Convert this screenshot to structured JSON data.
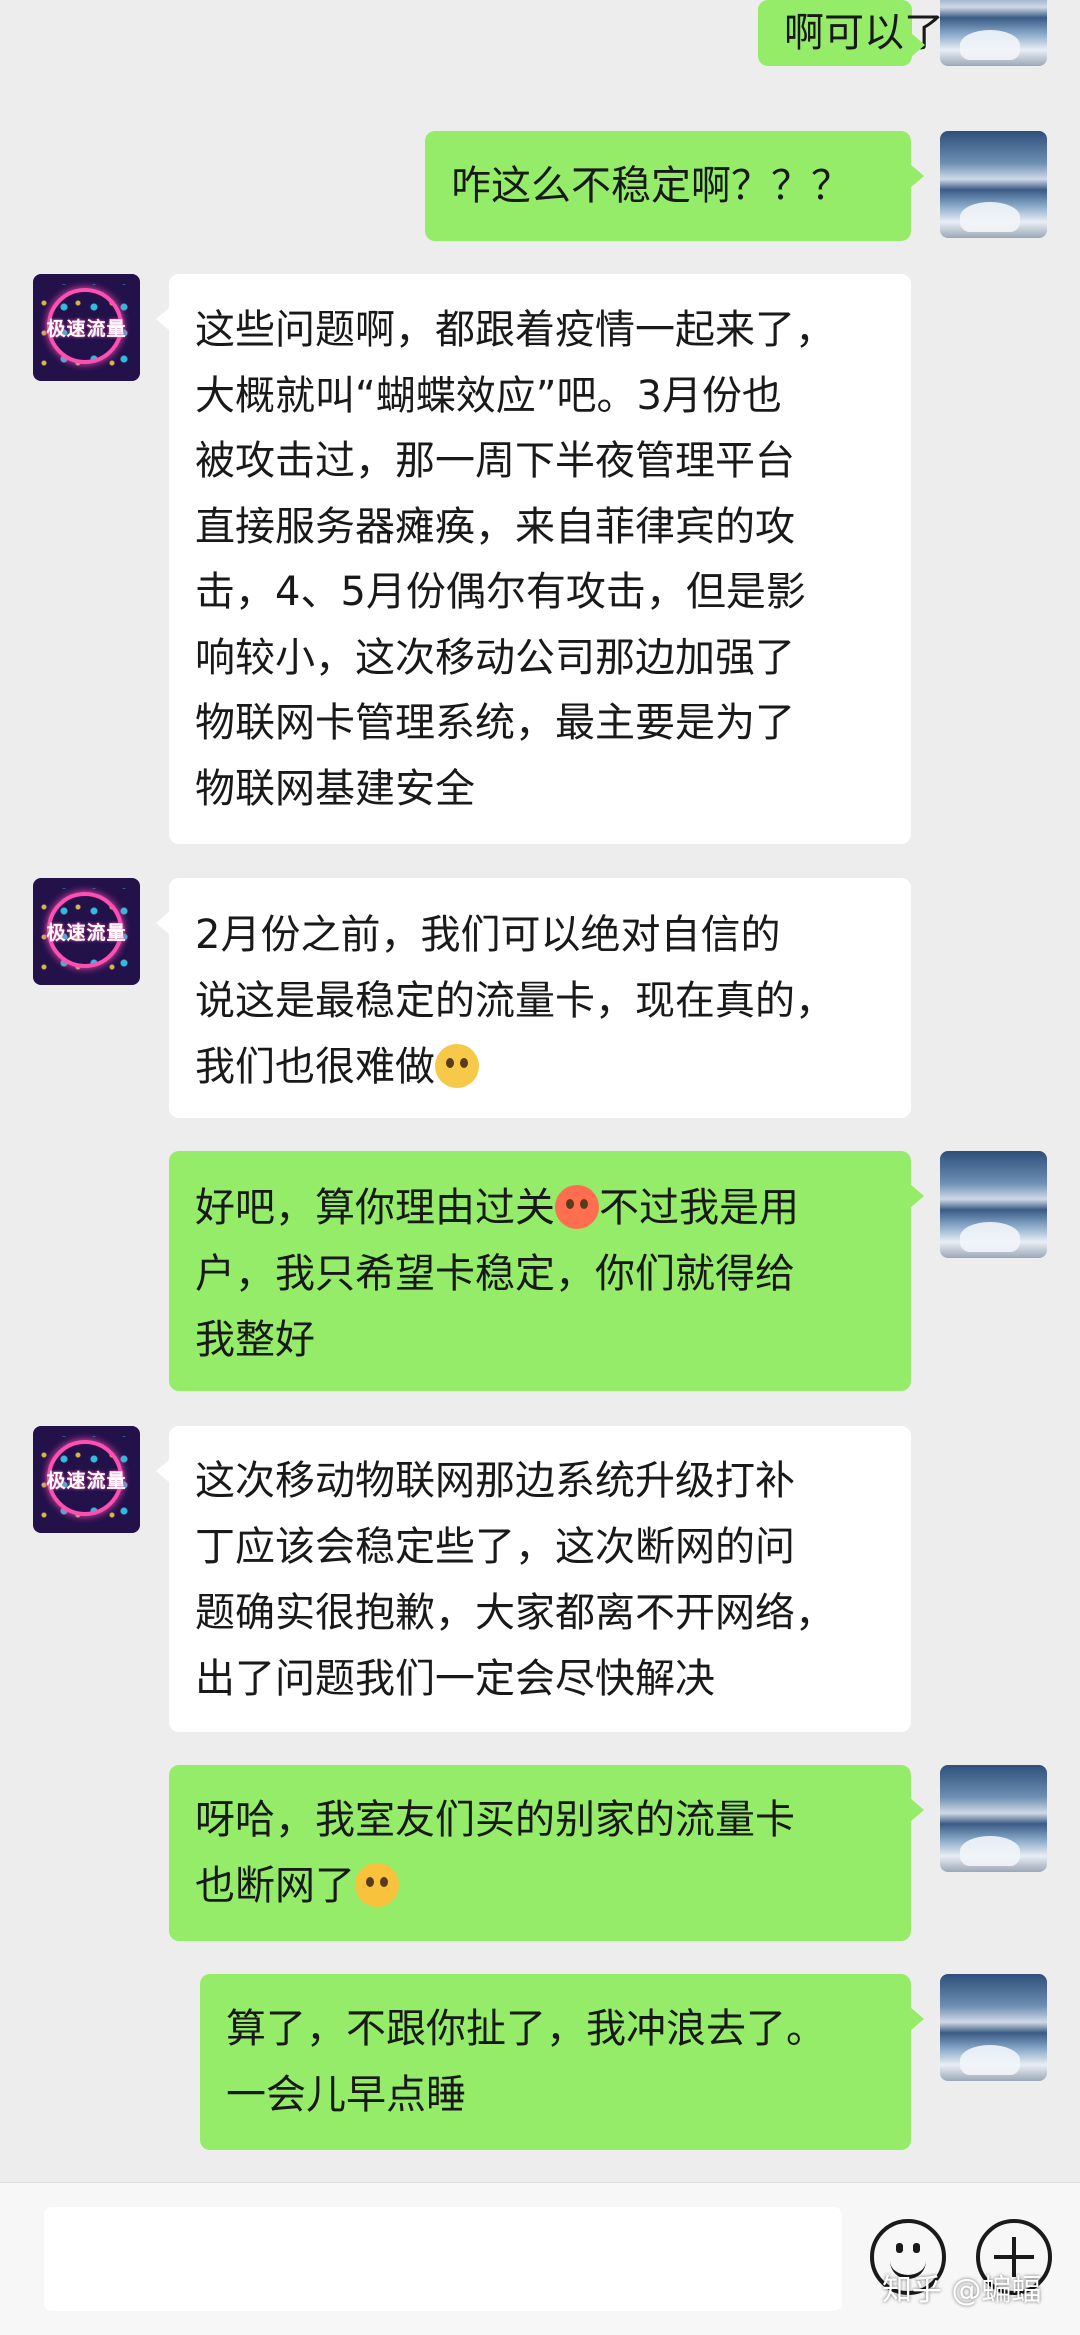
{
  "messages": [
    {
      "sender": "me",
      "lines": [
        "啊可以了"
      ]
    },
    {
      "sender": "me",
      "lines": [
        "咋这么不稳定啊？？？"
      ]
    },
    {
      "sender": "contact",
      "lines": [
        "这些问题啊，都跟着疫情一起来了，",
        "大概就叫“蝴蝶效应”吧。3月份也",
        "被攻击过，那一周下半夜管理平台",
        "直接服务器瘫痪，来自菲律宾的攻",
        "击，4、5月份偶尔有攻击，但是影",
        "响较小，这次移动公司那边加强了",
        "物联网卡管理系统，最主要是为了",
        "物联网基建安全"
      ]
    },
    {
      "sender": "contact",
      "lines": [
        "2月份之前，我们可以绝对自信的",
        "说这是最稳定的流量卡，现在真的，",
        "我们也很难做"
      ]
    },
    {
      "sender": "me",
      "lines": [
        "好吧，算你理由过关",
        "不过我是用",
        "户，我只希望卡稳定，你们就得给",
        "我整好"
      ]
    },
    {
      "sender": "contact",
      "lines": [
        "这次移动物联网那边系统升级打补",
        "丁应该会稳定些了，这次断网的问",
        "题确实很抱歉，大家都离不开网络，",
        "出了问题我们一定会尽快解决"
      ]
    },
    {
      "sender": "me",
      "lines": [
        "呀哈，我室友们买的别家的流量卡",
        "也断网了"
      ]
    },
    {
      "sender": "me",
      "lines": [
        "算了，不跟你扯了，我冲浪去了。",
        "一会儿早点睡"
      ]
    }
  ],
  "contact_avatar_text": "极速流量",
  "emojis": {
    "pleading": "pleading-face",
    "flushed": "flushed-face",
    "crying": "loudly-crying-face"
  },
  "input_bar": {
    "value": ""
  },
  "watermark": "知乎 @蝙蝠",
  "colors": {
    "outgoing_bubble": "#95ec69",
    "incoming_bubble": "#ffffff",
    "background": "#ededed"
  }
}
